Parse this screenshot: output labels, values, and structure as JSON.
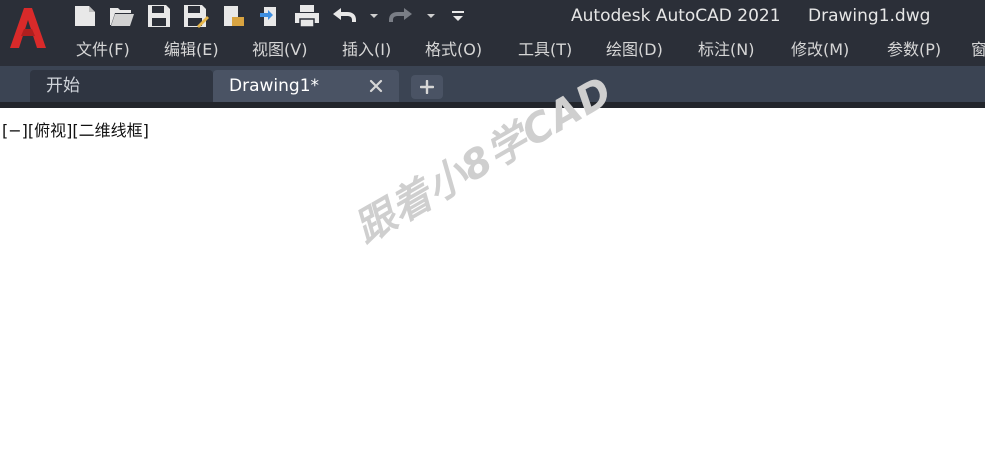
{
  "app": {
    "title": "Autodesk AutoCAD 2021",
    "document": "Drawing1.dwg"
  },
  "menu": [
    "文件(F)",
    "编辑(E)",
    "视图(V)",
    "插入(I)",
    "格式(O)",
    "工具(T)",
    "绘图(D)",
    "标注(N)",
    "修改(M)",
    "参数(P)",
    "窗"
  ],
  "tabs": {
    "start": "开始",
    "drawing": "Drawing1*"
  },
  "viewport": {
    "controls": "[−][俯视][二维线框]",
    "watermark": "跟着小8学CAD"
  },
  "colors": {
    "title_bar": "#2b2f38",
    "tab_strip": "#3b4453",
    "active_tab": "#4a5364",
    "logo_red": "#d92a2a"
  },
  "icons": [
    "autocad-logo-icon",
    "new-file-icon",
    "open-folder-icon",
    "save-icon",
    "save-as-icon",
    "open-from-web-icon",
    "publish-icon",
    "print-icon",
    "undo-icon",
    "redo-icon",
    "customize-dropdown-icon",
    "close-icon",
    "plus-icon"
  ]
}
